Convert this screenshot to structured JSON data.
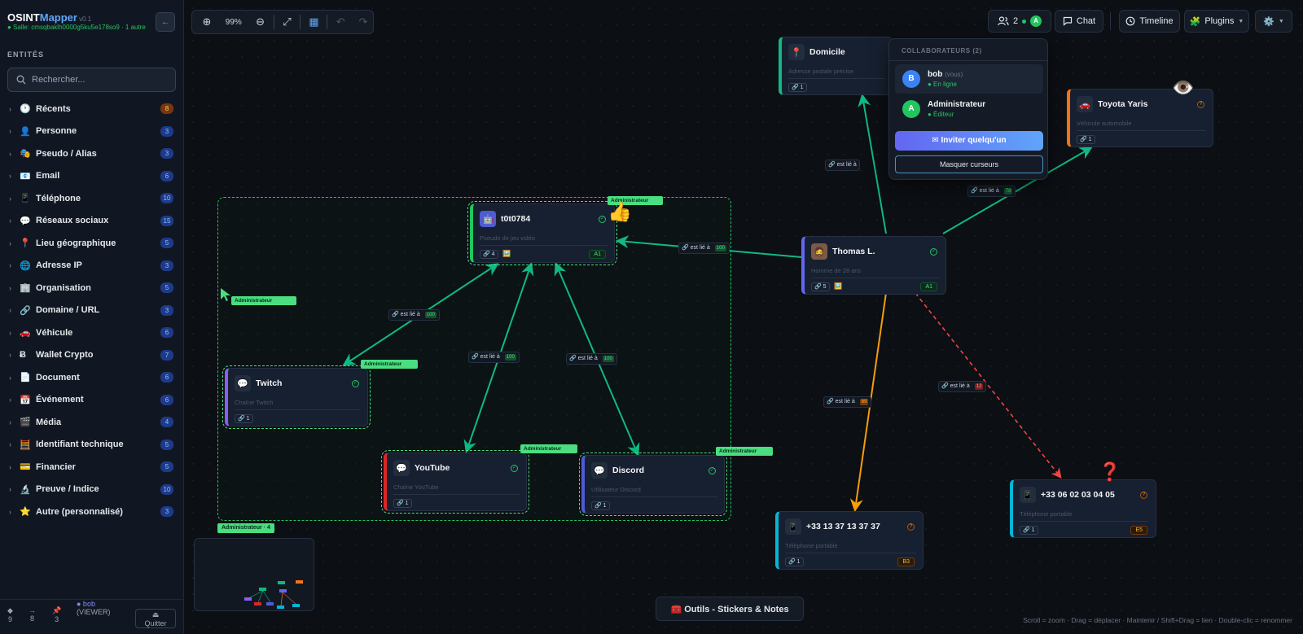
{
  "app": {
    "name_part1": "OSINT",
    "name_part2": "Mapper",
    "version": "v0.1",
    "room": "● Salle: cmsqbaklh0000g5ku5e178so9 · 1 autre",
    "collapse_icon": "←"
  },
  "sidebar": {
    "section_title": "ENTITÉS",
    "search_placeholder": "Rechercher...",
    "categories": [
      {
        "icon": "🕐",
        "label": "Récents",
        "count": "8"
      },
      {
        "icon": "👤",
        "label": "Personne",
        "count": "3"
      },
      {
        "icon": "🎭",
        "label": "Pseudo / Alias",
        "count": "3"
      },
      {
        "icon": "📧",
        "label": "Email",
        "count": "6"
      },
      {
        "icon": "📱",
        "label": "Téléphone",
        "count": "10"
      },
      {
        "icon": "💬",
        "label": "Réseaux sociaux",
        "count": "15"
      },
      {
        "icon": "📍",
        "label": "Lieu géographique",
        "count": "5"
      },
      {
        "icon": "🌐",
        "label": "Adresse IP",
        "count": "3"
      },
      {
        "icon": "🏢",
        "label": "Organisation",
        "count": "5"
      },
      {
        "icon": "🔗",
        "label": "Domaine / URL",
        "count": "3"
      },
      {
        "icon": "🚗",
        "label": "Véhicule",
        "count": "6"
      },
      {
        "icon": "Ƀ",
        "label": "Wallet Crypto",
        "count": "7"
      },
      {
        "icon": "📄",
        "label": "Document",
        "count": "6"
      },
      {
        "icon": "📅",
        "label": "Événement",
        "count": "6"
      },
      {
        "icon": "🎬",
        "label": "Média",
        "count": "4"
      },
      {
        "icon": "🧮",
        "label": "Identifiant technique",
        "count": "5"
      },
      {
        "icon": "💳",
        "label": "Financier",
        "count": "5"
      },
      {
        "icon": "🔬",
        "label": "Preuve / Indice",
        "count": "10"
      },
      {
        "icon": "⭐",
        "label": "Autre (personnalisé)",
        "count": "3"
      }
    ],
    "footer": {
      "nodes_icon": "◆",
      "nodes": "9",
      "links_icon": "→",
      "links": "8",
      "pins_icon": "📌",
      "pins": "3",
      "user": "● bob",
      "role": "(VIEWER)",
      "quit_icon": "⏏",
      "quit": "Quitter"
    }
  },
  "toolbar": {
    "zoom": "99%",
    "zoom_in_icon": "⊕",
    "zoom_out_icon": "⊖",
    "fit_icon": "⤢",
    "grid_icon": "▦",
    "undo_icon": "↶",
    "redo_icon": "↷"
  },
  "topbar": {
    "users_count": "2",
    "user_avatar": "A",
    "chat": "Chat",
    "timeline": "Timeline",
    "plugins": "Plugins",
    "settings_icon": "⚙️"
  },
  "collaborators": {
    "title": "COLLABORATEURS (2)",
    "users": [
      {
        "initial": "B",
        "name": "bob",
        "tag": "(vous)",
        "role": "● En ligne",
        "color": "#3b82f6",
        "role_color": "#22c55e"
      },
      {
        "initial": "A",
        "name": "Administrateur",
        "tag": "",
        "role": "● Éditeur",
        "color": "#22c55e",
        "role_color": "#22c55e"
      }
    ],
    "invite": "✉ Inviter quelqu'un",
    "hide_cursors": "Masquer curseurs"
  },
  "group": {
    "label": "Administrateur · 4"
  },
  "cursor_tags": [
    "Administrateur",
    "Administrateur",
    "Administrateur",
    "Administrateur",
    "Administrateur",
    "Administrateur"
  ],
  "nodes": [
    {
      "id": "t0t0784",
      "title": "t0t0784",
      "subtitle": "Pseudo de jeu vidéo",
      "links": "🔗 4",
      "img": "🖼️",
      "grade": "A1",
      "icon": "🤖",
      "color": "#22c55e",
      "status": "✓"
    },
    {
      "id": "twitch",
      "title": "Twitch",
      "subtitle": "Chaîne Twitch",
      "links": "🔗 1",
      "icon": "💬",
      "color": "#8b5cf6",
      "status": "✓"
    },
    {
      "id": "youtube",
      "title": "YouTube",
      "subtitle": "Chaîne YouTube",
      "links": "🔗 1",
      "icon": "💬",
      "color": "#dc2626",
      "status": "✓"
    },
    {
      "id": "discord",
      "title": "Discord",
      "subtitle": "Utilisateur Discord",
      "links": "🔗 1",
      "icon": "💬",
      "color": "#4f5bd5",
      "status": "✓"
    },
    {
      "id": "thomas",
      "title": "Thomas L.",
      "subtitle": "Homme de 28 ans",
      "links": "🔗 5",
      "img": "🖼️",
      "grade": "A1",
      "icon": "🧔",
      "color": "#6366f1",
      "status": "✓"
    },
    {
      "id": "domicile",
      "title": "Domicile",
      "subtitle": "Adresse postale précise",
      "links": "🔗 1",
      "icon": "📍",
      "color": "#10b981"
    },
    {
      "id": "toyota",
      "title": "Toyota Yaris",
      "subtitle": "Véhicule automobile",
      "links": "🔗 1",
      "icon": "🚗",
      "color": "#f97316",
      "status": "?"
    },
    {
      "id": "phone1",
      "title": "+33 13 37 13 37 37",
      "subtitle": "Téléphone portable",
      "links": "🔗 1",
      "grade": "B3",
      "icon": "📱",
      "color": "#06b6d4",
      "status": "?"
    },
    {
      "id": "phone2",
      "title": "+33 06 02 03 04 05",
      "subtitle": "Téléphone portable",
      "links": "🔗 1",
      "grade": "E5",
      "icon": "📱",
      "color": "#06b6d4",
      "status": "?"
    }
  ],
  "edges": [
    {
      "label": "🔗 est lié à",
      "score": "100"
    },
    {
      "label": "🔗 est lié à",
      "score": "100"
    },
    {
      "label": "🔗 est lié à",
      "score": "100"
    },
    {
      "label": "🔗 est lié à",
      "score": "100"
    },
    {
      "label": "🔗 est lié à",
      "score": ""
    },
    {
      "label": "🔗 est lié à",
      "score": "78"
    },
    {
      "label": "🔗 est lié à",
      "score": "69"
    },
    {
      "label": "🔗 est lié à",
      "score": "12"
    }
  ],
  "stickers": {
    "thumbs": "👍",
    "eye": "👁️",
    "question": "❓"
  },
  "tools_button": "🧰 Outils - Stickers & Notes",
  "hint": "Scroll = zoom · Drag = déplacer · Maintenir / Shift+Drag = lien · Double-clic = renommer"
}
